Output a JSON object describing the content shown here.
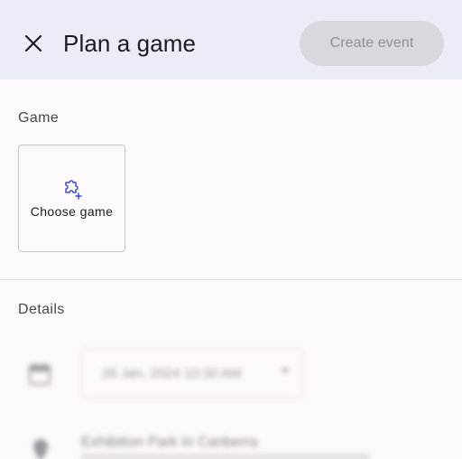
{
  "header": {
    "title": "Plan a game",
    "create_label": "Create event"
  },
  "game_section": {
    "label": "Game",
    "choose_label": "Choose game",
    "icon": "puzzle-add-icon"
  },
  "details_section": {
    "label": "Details",
    "date_value": "26 Jan, 2024 10:30 AM",
    "location_name": "Exhibition Park In Canberra"
  },
  "colors": {
    "header_bg": "#ececf6",
    "page_bg": "#fdf8fc",
    "accent": "#3b4fc8",
    "disabled_button_bg": "#d9d8de",
    "disabled_button_text": "#8f8e94"
  }
}
